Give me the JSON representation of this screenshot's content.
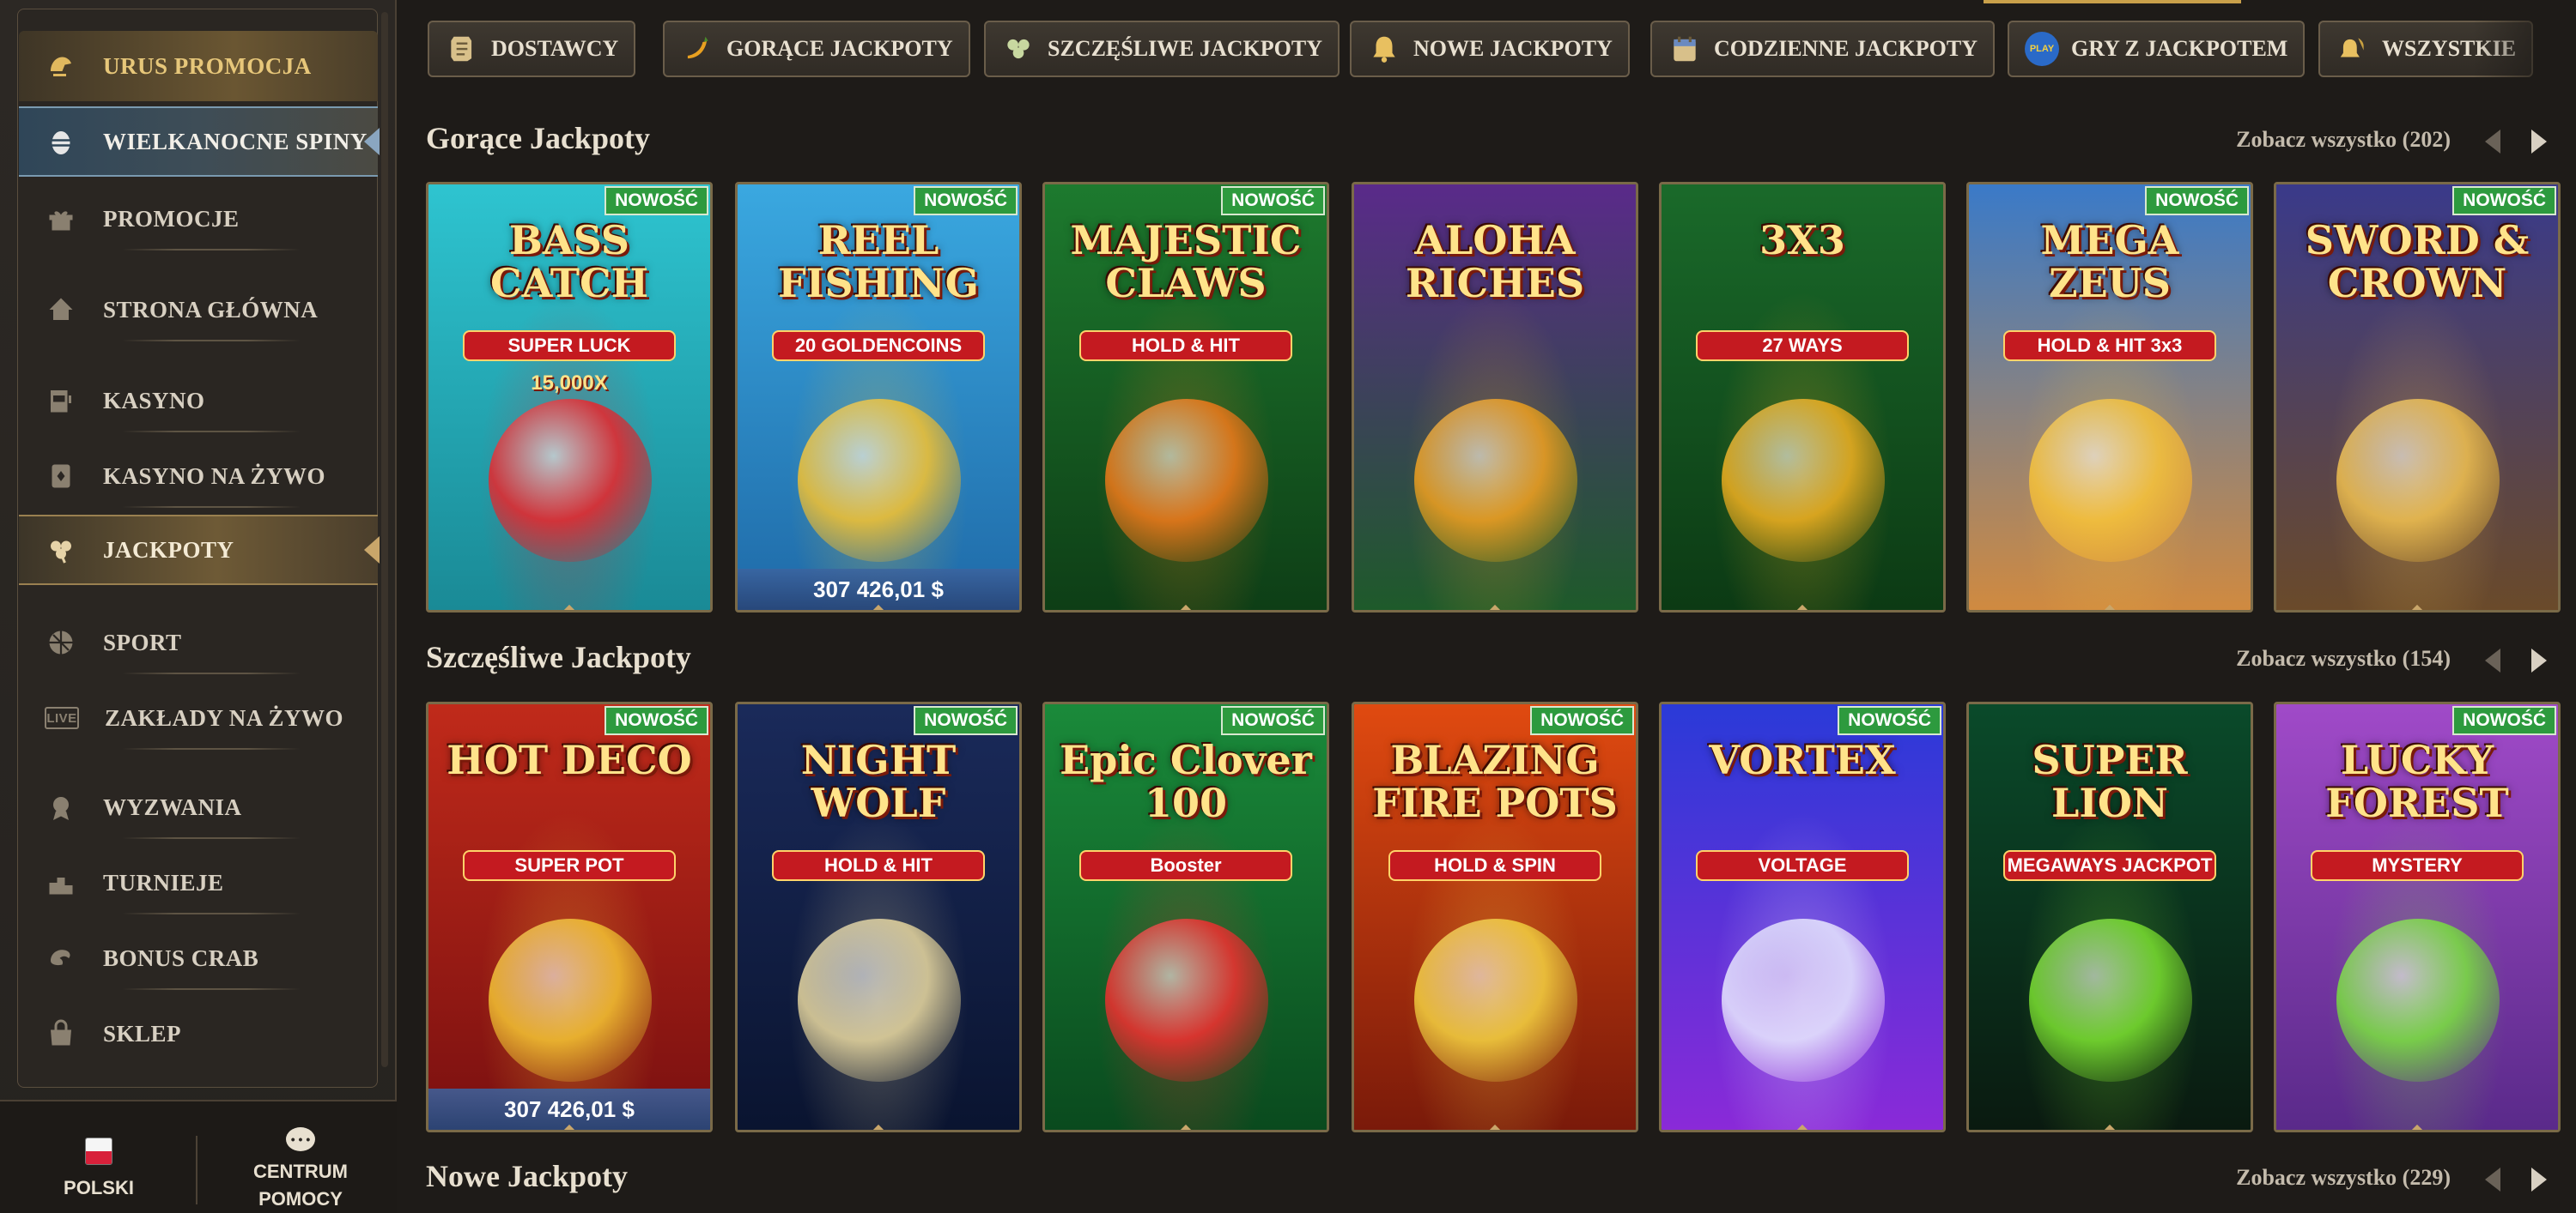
{
  "sidebar": {
    "items": [
      {
        "label": "URUS PROMOCJA",
        "icon": "helmet-icon"
      },
      {
        "label": "WIELKANOCNE SPINY",
        "icon": "easter-egg-icon"
      },
      {
        "label": "PROMOCJE",
        "icon": "gift-icon"
      },
      {
        "label": "STRONA GŁÓWNA",
        "icon": "home-icon"
      },
      {
        "label": "KASYNO",
        "icon": "slot-machine-icon"
      },
      {
        "label": "KASYNO NA ŻYWO",
        "icon": "playing-card-icon"
      },
      {
        "label": "JACKPOTY",
        "icon": "clover-icon"
      },
      {
        "label": "SPORT",
        "icon": "ball-icon"
      },
      {
        "label": "ZAKŁADY NA ŻYWO",
        "icon": "live-icon",
        "icon_text": "LIVE"
      },
      {
        "label": "WYZWANIA",
        "icon": "medal-icon"
      },
      {
        "label": "TURNIEJE",
        "icon": "podium-icon"
      },
      {
        "label": "BONUS CRAB",
        "icon": "claw-icon"
      },
      {
        "label": "SKLEP",
        "icon": "bag-icon"
      }
    ],
    "footer": {
      "language": "POLSKI",
      "help": "CENTRUM POMOCY"
    }
  },
  "tabs": [
    {
      "label": "DOSTAWCY",
      "icon": "scroll-icon"
    },
    {
      "label": "GORĄCE JACKPOTY",
      "icon": "chili-icon"
    },
    {
      "label": "SZCZĘŚLIWE JACKPOTY",
      "icon": "clover-icon"
    },
    {
      "label": "NOWE JACKPOTY",
      "icon": "bell-icon"
    },
    {
      "label": "CODZIENNE JACKPOTY",
      "icon": "calendar-icon"
    },
    {
      "label": "GRY Z JACKPOTEM",
      "icon": "play-icon",
      "icon_text": "PLAY"
    },
    {
      "label": "WSZYSTKIE",
      "icon": "bell-stack-icon"
    }
  ],
  "new_badge": "NOWOŚĆ",
  "sections": [
    {
      "title": "Gorące Jackpoty",
      "see_all": "Zobacz wszystko (202)",
      "games": [
        {
          "title": "BASS CATCH",
          "sub": "SUPER LUCK",
          "extra": "15,000X",
          "new": true,
          "bg1": "#2ec4d0",
          "bg2": "#1a8a96",
          "accent": "#e8262c"
        },
        {
          "title": "REEL FISHING",
          "sub": "20 GOLDENCOINS",
          "jackpot": "307 426,01 $",
          "new": true,
          "bg1": "#3aa8e0",
          "bg2": "#1f6aa8",
          "accent": "#f3c232"
        },
        {
          "title": "MAJESTIC CLAWS",
          "sub": "HOLD & HIT",
          "new": true,
          "bg1": "#1d7a2e",
          "bg2": "#0e3e16",
          "accent": "#f07a1a"
        },
        {
          "title": "ALOHA RICHES",
          "new": false,
          "bg1": "#5a2a8a",
          "bg2": "#1e5a2a",
          "accent": "#f0a020"
        },
        {
          "title": "3X3",
          "sub": "27 WAYS",
          "new": false,
          "bg1": "#1a6a2a",
          "bg2": "#0c3a14",
          "accent": "#f0b020"
        },
        {
          "title": "MEGA ZEUS",
          "sub": "HOLD & HIT 3x3",
          "new": true,
          "bg1": "#3a7ac8",
          "bg2": "#d08a40",
          "accent": "#f6c23a"
        },
        {
          "title": "SWORD & CROWN",
          "new": true,
          "bg1": "#3a3a8a",
          "bg2": "#6a4a2a",
          "accent": "#f0c050"
        }
      ]
    },
    {
      "title": "Szczęśliwe Jackpoty",
      "see_all": "Zobacz wszystko (154)",
      "games": [
        {
          "title": "HOT DECO",
          "sub": "SUPER POT",
          "jackpot": "307 426,01 $",
          "new": true,
          "bg1": "#c02a1a",
          "bg2": "#7a1010",
          "accent": "#f3c232"
        },
        {
          "title": "NIGHT WOLF",
          "sub": "HOLD & HIT",
          "new": true,
          "bg1": "#1a2a5a",
          "bg2": "#0a1430",
          "accent": "#e8d8a0"
        },
        {
          "title": "Epic Clover 100",
          "sub": "Booster",
          "new": true,
          "bg1": "#1a8a3a",
          "bg2": "#0a4a1e",
          "accent": "#f03030"
        },
        {
          "title": "BLAZING FIRE POTS",
          "sub": "HOLD & SPIN",
          "new": true,
          "bg1": "#e04a10",
          "bg2": "#7a1a0a",
          "accent": "#f3d040"
        },
        {
          "title": "VORTEX",
          "sub": "VOLTAGE",
          "new": true,
          "bg1": "#2a3ad8",
          "bg2": "#8a2ad8",
          "accent": "#e8e8ff"
        },
        {
          "title": "SUPER LION",
          "sub": "MEGAWAYS JACKPOT",
          "new": false,
          "bg1": "#0a4a2a",
          "bg2": "#0a1a10",
          "accent": "#7ae030"
        },
        {
          "title": "LUCKY FOREST",
          "sub": "MYSTERY",
          "new": true,
          "bg1": "#a04ac8",
          "bg2": "#5a2a8a",
          "accent": "#7ae040"
        }
      ]
    },
    {
      "title": "Nowe Jackpoty",
      "see_all": "Zobacz wszystko (229)"
    }
  ],
  "colors": {
    "background": "#1e1b18",
    "new_badge": "#2d9a3e",
    "gold": "#c9a66a"
  }
}
